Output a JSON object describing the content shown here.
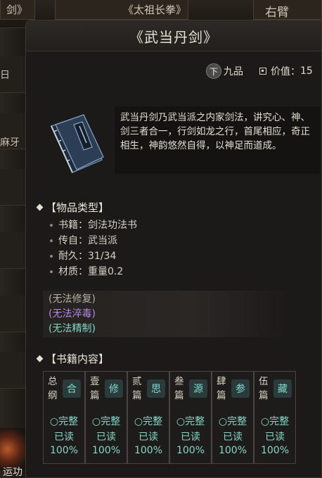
{
  "background": {
    "tab_left": "剑》",
    "tab_middle": "《太祖长拳》",
    "tab_right": "右臂",
    "left_labels": [
      "日",
      "麻牙",
      "运功"
    ]
  },
  "tooltip": {
    "title": "《武当丹剑》",
    "grade_icon": "下",
    "grade": "九品",
    "value_label": "价值：",
    "value": "15",
    "description": "武当丹剑乃武当派之内家剑法，讲究心、神、剑三者合一，行剑如龙之行，首尾相应，奇正相生，神韵悠然自得，以神足而道成。",
    "sections": {
      "type_header": "【物品类型】",
      "content_header": "【书籍内容】"
    },
    "properties": [
      {
        "label": "书籍：",
        "value": "剑法功法书"
      },
      {
        "label": "传自：",
        "value": "武当派"
      },
      {
        "label": "耐久：",
        "value": "31/34"
      },
      {
        "label": "材质：",
        "value": "重量0.2"
      }
    ],
    "flags": [
      "(无法修复)",
      "(无法淬毒)",
      "(无法精制)"
    ],
    "chapters": [
      {
        "name": "总纲",
        "badge": "合",
        "status": "○完整",
        "read": "已读",
        "percent": "100%"
      },
      {
        "name": "壹篇",
        "badge": "修",
        "status": "○完整",
        "read": "已读",
        "percent": "100%"
      },
      {
        "name": "贰篇",
        "badge": "思",
        "status": "○完整",
        "read": "已读",
        "percent": "100%"
      },
      {
        "name": "叁篇",
        "badge": "源",
        "status": "○完整",
        "read": "已读",
        "percent": "100%"
      },
      {
        "name": "肆篇",
        "badge": "参",
        "status": "○完整",
        "read": "已读",
        "percent": "100%"
      },
      {
        "name": "伍篇",
        "badge": "藏",
        "status": "○完整",
        "read": "已读",
        "percent": "100%"
      }
    ]
  }
}
